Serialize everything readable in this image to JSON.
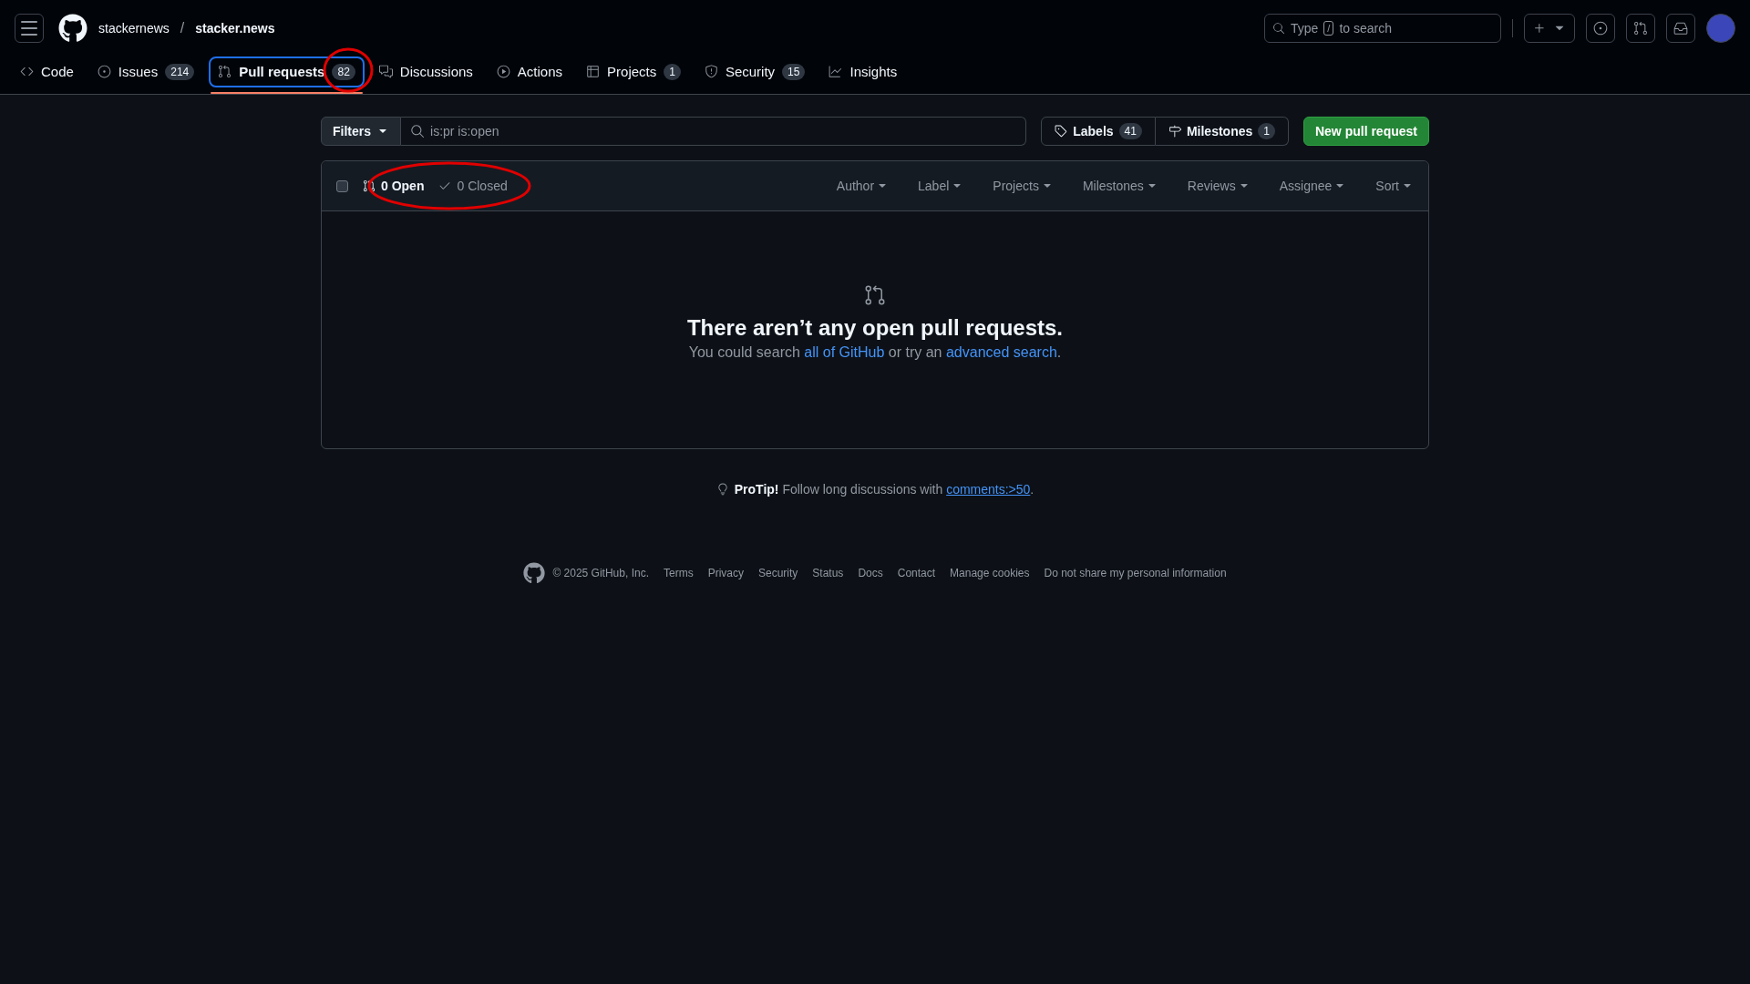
{
  "header": {
    "owner": "stackernews",
    "separator": "/",
    "repo": "stacker.news",
    "search": {
      "before": "Type",
      "key": "/",
      "after": "to search"
    }
  },
  "tabs": [
    {
      "kind": "code",
      "label": "Code",
      "selected": false,
      "circled": false
    },
    {
      "kind": "issues",
      "label": "Issues",
      "count": "214",
      "selected": false,
      "circled": false
    },
    {
      "kind": "pulls",
      "label": "Pull requests",
      "count": "82",
      "selected": true,
      "circled": true
    },
    {
      "kind": "discussions",
      "label": "Discussions",
      "selected": false,
      "circled": false
    },
    {
      "kind": "actions",
      "label": "Actions",
      "selected": false,
      "circled": false
    },
    {
      "kind": "projects",
      "label": "Projects",
      "count": "1",
      "selected": false,
      "circled": false
    },
    {
      "kind": "security",
      "label": "Security",
      "count": "15",
      "selected": false,
      "circled": false
    },
    {
      "kind": "insights",
      "label": "Insights",
      "selected": false,
      "circled": false
    }
  ],
  "filter_bar": {
    "filters": "Filters",
    "query": "is:pr is:open",
    "labels": {
      "label": "Labels",
      "count": "41"
    },
    "milestones": {
      "label": "Milestones",
      "count": "1"
    },
    "new_button": "New pull request"
  },
  "list_header": {
    "checked": false,
    "circled": true,
    "states": [
      {
        "kind": "open",
        "label": "0 Open",
        "selected": true
      },
      {
        "kind": "closed",
        "label": "0 Closed",
        "selected": false
      }
    ],
    "menus": [
      "Author",
      "Label",
      "Projects",
      "Milestones",
      "Reviews",
      "Assignee",
      "Sort"
    ]
  },
  "empty_state": {
    "title": "There aren’t any open pull requests.",
    "parts": [
      {
        "kind": "text",
        "text": "You could search "
      },
      {
        "kind": "link",
        "text": "all of GitHub"
      },
      {
        "kind": "text",
        "text": " or try an "
      },
      {
        "kind": "link",
        "text": "advanced search"
      },
      {
        "kind": "text",
        "text": "."
      }
    ]
  },
  "protip": {
    "lead": "**ProTip!** Follow long discussions with ",
    "link": "comments:>50",
    "tail": "."
  },
  "footer": {
    "copyright": "© 2025 GitHub, Inc.",
    "links": [
      "Terms",
      "Privacy",
      "Security",
      "Status",
      "Docs",
      "Contact",
      "Manage cookies",
      "Do not share my personal information"
    ]
  }
}
